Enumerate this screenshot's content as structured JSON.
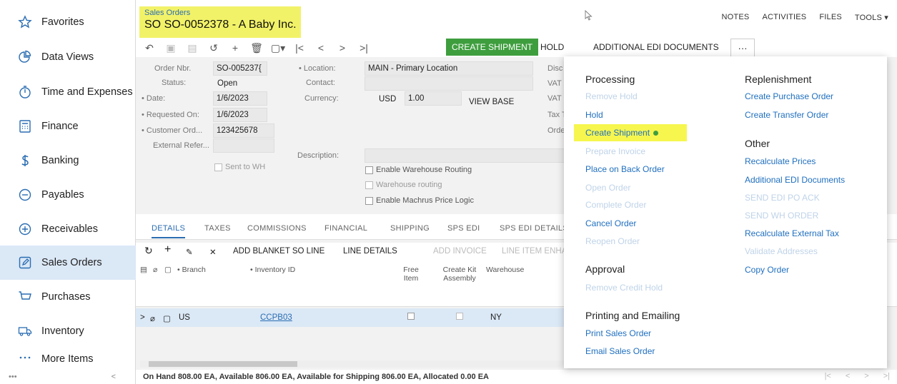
{
  "sidebar": {
    "items": [
      {
        "label": "Favorites",
        "icon": "star-icon"
      },
      {
        "label": "Data Views",
        "icon": "pie-chart-icon"
      },
      {
        "label": "Time and Expenses",
        "icon": "stopwatch-icon"
      },
      {
        "label": "Finance",
        "icon": "calculator-icon"
      },
      {
        "label": "Banking",
        "icon": "dollar-icon"
      },
      {
        "label": "Payables",
        "icon": "minus-circle-icon"
      },
      {
        "label": "Receivables",
        "icon": "plus-circle-icon"
      },
      {
        "label": "Sales Orders",
        "icon": "edit-icon"
      },
      {
        "label": "Purchases",
        "icon": "cart-icon"
      },
      {
        "label": "Inventory",
        "icon": "truck-icon"
      },
      {
        "label": "More Items",
        "icon": "grid-dots-icon"
      }
    ],
    "footer_dots": "•••",
    "collapse": "<",
    "active_color": "#dbe8f6"
  },
  "header": {
    "breadcrumb": "Sales Orders",
    "title": "SO SO-0052378 - A Baby Inc.",
    "highlight_color": "#f2f268",
    "links": [
      "NOTES",
      "ACTIVITIES",
      "FILES",
      "TOOLS ▾"
    ]
  },
  "toolbar": {
    "create_shipment": "CREATE SHIPMENT",
    "hold": "HOLD",
    "additional_edi": "ADDITIONAL EDI DOCUMENTS",
    "more": "···",
    "accent": "#3e9e3e"
  },
  "form": {
    "order_nbr_label": "Order Nbr.",
    "order_nbr": "SO-005237{",
    "status_label": "Status:",
    "status": "Open",
    "date_label": "• Date:",
    "date": "1/6/2023",
    "requested_label": "• Requested On:",
    "requested": "1/6/2023",
    "customer_ord_label": "• Customer Ord...",
    "customer_ord": "123425678",
    "external_ref_label": "External Refer...",
    "sent_to_wh": "Sent to WH",
    "location_label": "• Location:",
    "location": "MAIN - Primary Location",
    "contact_label": "Contact:",
    "currency_label": "Currency:",
    "currency": "USD",
    "rate": "1.00",
    "view_base": "VIEW BASE",
    "description_label": "Description:",
    "enable_warehouse_routing": "Enable Warehouse Routing",
    "warehouse_routing": "Warehouse routing",
    "enable_machrus": "Enable Machrus Price Logic",
    "right_labels": [
      "Disc",
      "VAT",
      "VAT",
      "Tax T",
      "Orde"
    ]
  },
  "tabs": [
    "DETAILS",
    "TAXES",
    "COMMISSIONS",
    "FINANCIAL",
    "SHIPPING",
    "SPS EDI",
    "SPS EDI DETAILS"
  ],
  "grid_toolbar": {
    "add_blanket": "ADD BLANKET SO LINE",
    "line_details": "LINE DETAILS",
    "add_invoice": "ADD INVOICE",
    "line_item": "LINE ITEM ENHA"
  },
  "grid": {
    "headers": {
      "branch": "• Branch",
      "inventory_id": "• Inventory ID",
      "free_item": "Free Item",
      "create_kit": "Create Kit Assembly",
      "warehouse": "Warehouse"
    },
    "row": {
      "branch": "US",
      "inventory_id": "CCPB03",
      "warehouse": "NY"
    }
  },
  "status_bar": "On Hand 808.00 EA, Available 806.00 EA, Available for Shipping 806.00 EA, Allocated 0.00 EA",
  "menu": {
    "processing_title": "Processing",
    "processing": [
      {
        "label": "Remove Hold",
        "enabled": false
      },
      {
        "label": "Hold",
        "enabled": true
      },
      {
        "label": "Create Shipment",
        "enabled": true
      },
      {
        "label": "Prepare Invoice",
        "enabled": false
      },
      {
        "label": "Place on Back Order",
        "enabled": true
      },
      {
        "label": "Open Order",
        "enabled": false
      },
      {
        "label": "Complete Order",
        "enabled": false
      },
      {
        "label": "Cancel Order",
        "enabled": true
      },
      {
        "label": "Reopen Order",
        "enabled": false
      }
    ],
    "approval_title": "Approval",
    "approval": [
      {
        "label": "Remove Credit Hold",
        "enabled": false
      }
    ],
    "printing_title": "Printing and Emailing",
    "printing": [
      {
        "label": "Print Sales Order",
        "enabled": true
      },
      {
        "label": "Email Sales Order",
        "enabled": true
      }
    ],
    "replenishment_title": "Replenishment",
    "replenishment": [
      {
        "label": "Create Purchase Order",
        "enabled": true
      },
      {
        "label": "Create Transfer Order",
        "enabled": true
      }
    ],
    "other_title": "Other",
    "other": [
      {
        "label": "Recalculate Prices",
        "enabled": true
      },
      {
        "label": "Additional EDI Documents",
        "enabled": true
      },
      {
        "label": "SEND EDI PO ACK",
        "enabled": false
      },
      {
        "label": "SEND WH ORDER",
        "enabled": false
      },
      {
        "label": "Recalculate External Tax",
        "enabled": true
      },
      {
        "label": "Validate Addresses",
        "enabled": false
      },
      {
        "label": "Copy Order",
        "enabled": true
      }
    ],
    "link_color": "#1f6fbf"
  }
}
